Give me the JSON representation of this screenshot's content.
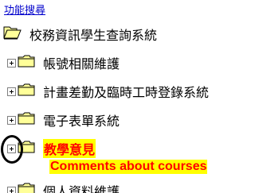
{
  "search_link": "功能搜尋",
  "root_folder": {
    "label": "校務資訊學生查詢系統",
    "icon": "folder-open-icon"
  },
  "tree_items": [
    {
      "label": "帳號相關維護",
      "icon": "folder-icon"
    },
    {
      "label": "計畫差勤及臨時工時登錄系統",
      "icon": "folder-icon"
    },
    {
      "label": "電子表單系統",
      "icon": "folder-icon"
    },
    {
      "label": "教學意見",
      "icon": "folder-icon",
      "highlighted": true
    },
    {
      "label": "個人資料維護",
      "icon": "folder-icon"
    }
  ],
  "annotation": "Comments about courses",
  "colors": {
    "link": "#0000cc",
    "highlight_text": "#ff0000",
    "highlight_bg": "#ffff00",
    "folder": "#ffff99"
  }
}
